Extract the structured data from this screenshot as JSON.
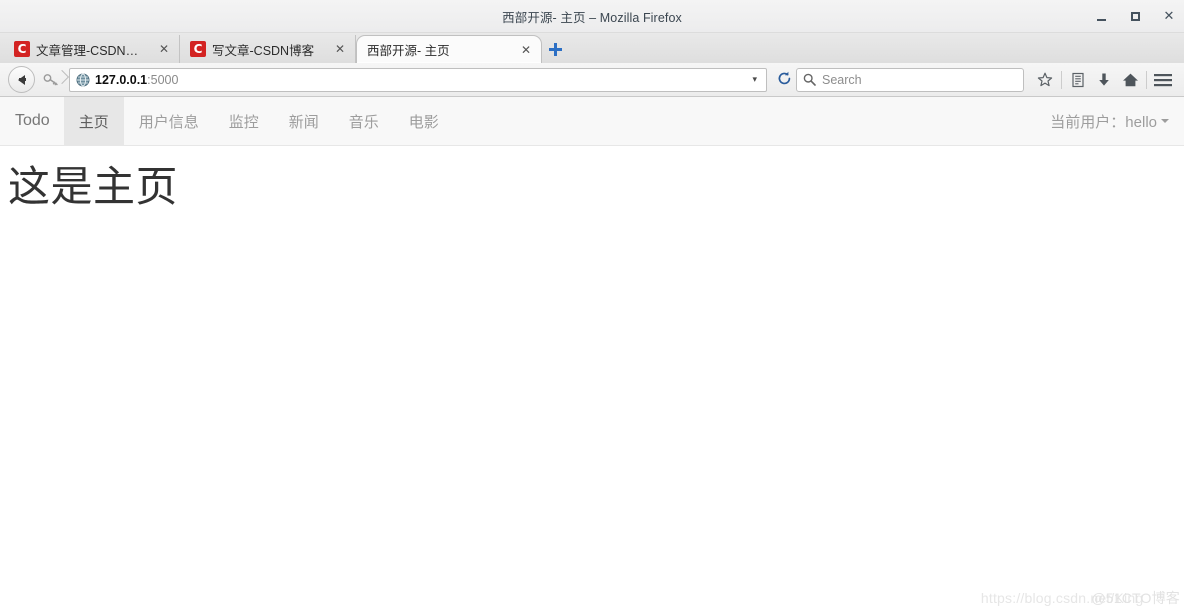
{
  "window": {
    "title": "西部开源- 主页 – Mozilla Firefox",
    "controls": {
      "minimize": "minimize-icon",
      "maximize": "maximize-icon",
      "close": "close-icon"
    }
  },
  "tabs": [
    {
      "title": "文章管理-CSDN博客",
      "favicon_letter": "C",
      "favicon_color": "#d32322",
      "active": false,
      "close_label": "✕"
    },
    {
      "title": "写文章-CSDN博客",
      "favicon_letter": "C",
      "favicon_color": "#d32322",
      "active": false,
      "close_label": "✕"
    },
    {
      "title": "西部开源- 主页",
      "favicon_letter": "",
      "favicon_color": "",
      "active": true,
      "close_label": "✕"
    }
  ],
  "newtab": {
    "label": "+"
  },
  "toolbar": {
    "back_label": "back-button",
    "identity_label": "identity-key-icon",
    "url_host": "127.0.0.1",
    "url_port": ":5000",
    "url_dropdown": "▾",
    "reload_label": "⟳",
    "search_placeholder": "Search",
    "icons": [
      "star-icon",
      "library-icon",
      "downloads-icon",
      "home-icon",
      "menu-icon"
    ]
  },
  "navbar": {
    "brand": "Todo",
    "items": [
      {
        "label": "主页",
        "active": true
      },
      {
        "label": "用户信息",
        "active": false
      },
      {
        "label": "监控",
        "active": false
      },
      {
        "label": "新闻",
        "active": false
      },
      {
        "label": "音乐",
        "active": false
      },
      {
        "label": "电影",
        "active": false
      }
    ],
    "user_label": "当前用户：hello",
    "active_bg": "#e7e7e7",
    "bg": "#f8f8f8"
  },
  "page": {
    "heading": "这是主页"
  },
  "watermark": {
    "url": "https://blog.csdn.net/King",
    "brand": "@51CTO博客"
  }
}
